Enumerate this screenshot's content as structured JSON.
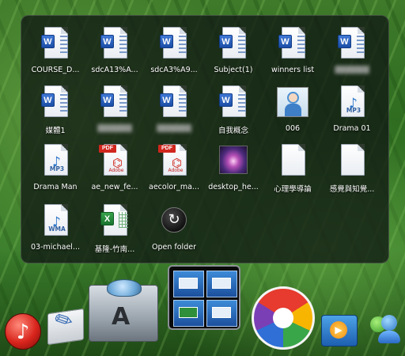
{
  "stack_items": [
    {
      "label": "COURSE_D...",
      "kind": "word",
      "icon": "word-doc-icon",
      "blurred": false
    },
    {
      "label": "sdcA13%A...",
      "kind": "word",
      "icon": "word-doc-icon",
      "blurred": false
    },
    {
      "label": "sdcA3%A9...",
      "kind": "word",
      "icon": "word-doc-icon",
      "blurred": false
    },
    {
      "label": "Subject(1)",
      "kind": "word",
      "icon": "word-doc-icon",
      "blurred": false
    },
    {
      "label": "winners list",
      "kind": "word",
      "icon": "word-doc-icon",
      "blurred": false
    },
    {
      "label": "",
      "kind": "word",
      "icon": "word-doc-icon",
      "blurred": true
    },
    {
      "label": "媒體1",
      "kind": "word",
      "icon": "word-doc-icon",
      "blurred": false
    },
    {
      "label": "",
      "kind": "word",
      "icon": "word-doc-icon",
      "blurred": true
    },
    {
      "label": "",
      "kind": "word",
      "icon": "word-doc-icon",
      "blurred": true
    },
    {
      "label": "自我概念",
      "kind": "word",
      "icon": "word-doc-icon",
      "blurred": false
    },
    {
      "label": "006",
      "kind": "photo",
      "icon": "photo-thumbnail-icon",
      "blurred": false
    },
    {
      "label": "Drama 01",
      "kind": "mp3",
      "icon": "mp3-file-icon",
      "blurred": false
    },
    {
      "label": "Drama Man",
      "kind": "mp3",
      "icon": "mp3-file-icon",
      "blurred": false
    },
    {
      "label": "ae_new_fe...",
      "kind": "pdf",
      "icon": "pdf-file-icon",
      "blurred": false
    },
    {
      "label": "aecolor_ma...",
      "kind": "pdf",
      "icon": "pdf-file-icon",
      "blurred": false
    },
    {
      "label": "desktop_he...",
      "kind": "image",
      "icon": "image-thumbnail-icon",
      "blurred": false
    },
    {
      "label": "心理學導論",
      "kind": "blank",
      "icon": "blank-doc-icon",
      "blurred": false
    },
    {
      "label": "感覺與知覺...",
      "kind": "blank",
      "icon": "blank-doc-icon",
      "blurred": false
    },
    {
      "label": "03-michael...",
      "kind": "wma",
      "icon": "wma-file-icon",
      "blurred": false
    },
    {
      "label": "基隆-竹南...",
      "kind": "excel",
      "icon": "excel-file-icon",
      "blurred": false
    },
    {
      "label": "Open folder",
      "kind": "open",
      "icon": "open-folder-arrow-icon",
      "blurred": false
    }
  ],
  "file_badges": {
    "word": "W",
    "excel": "X",
    "pdf": "PDF",
    "pdf_brand": "Adobe",
    "mp3": "MP3",
    "wma": "WMA"
  },
  "dock": [
    {
      "name": "music-app-icon"
    },
    {
      "name": "quill-writer-icon"
    },
    {
      "name": "installer-icon"
    },
    {
      "name": "spaces-icon"
    },
    {
      "name": "picasa-icon"
    },
    {
      "name": "media-player-icon"
    },
    {
      "name": "messenger-icon"
    }
  ],
  "colors": {
    "panel_bg": "rgba(18,26,20,0.80)",
    "label_text": "#ffffff",
    "word_blue": "#1b4ea6",
    "pdf_red": "#d0261d",
    "excel_green": "#1a7330"
  }
}
